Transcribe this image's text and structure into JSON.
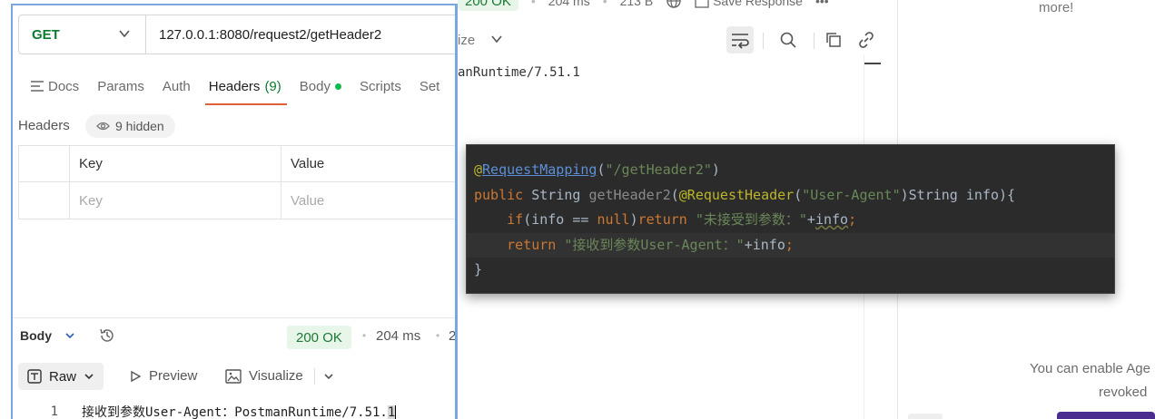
{
  "background": {
    "status": "200 OK",
    "time": "204 ms",
    "size": "213 B",
    "save_response": "Save Response",
    "visualize_fragment": "ize",
    "body_fragment": "anRuntime/7.51.1",
    "right_more": "more!",
    "right_enable": "You can enable Age",
    "right_revoked": "revoked"
  },
  "code": {
    "line1": {
      "at": "@",
      "anno": "RequestMapping",
      "open": "(",
      "str": "\"/getHeader2\"",
      "close": ")"
    },
    "line2": {
      "kw": "public ",
      "type": "String ",
      "fn": "getHeader2",
      "p1": "(",
      "anno": "@RequestHeader",
      "p2": "(",
      "str": "\"User-Agent\"",
      "p3": ")String info){"
    },
    "line3": {
      "kw1": "if",
      "cond": "(info == ",
      "kw2": "null",
      "p": ")",
      "kw3": "return ",
      "str": "\"未接受到参数：\"",
      "plus": "+",
      "var": "info",
      "semi": ";"
    },
    "line4": {
      "kw": "return ",
      "str": "\"接收到参数User-Agent：\"",
      "plus": "+info",
      "semi": ";"
    },
    "line5": "}"
  },
  "request": {
    "method": "GET",
    "url": "127.0.0.1:8080/request2/getHeader2",
    "tabs": [
      {
        "label": "Docs"
      },
      {
        "label": "Params"
      },
      {
        "label": "Auth"
      },
      {
        "label": "Headers",
        "count": "(9)"
      },
      {
        "label": "Body"
      },
      {
        "label": "Scripts"
      },
      {
        "label": "Set"
      }
    ],
    "headers_label": "Headers",
    "hidden_count": "9 hidden",
    "table": {
      "col_key": "Key",
      "col_value": "Value",
      "placeholder_key": "Key",
      "placeholder_value": "Value"
    }
  },
  "response": {
    "body_label": "Body",
    "status": "200 OK",
    "dot": "•",
    "time": "204 ms",
    "size_fragment": "2",
    "formats": {
      "raw": "Raw",
      "preview": "Preview",
      "visualize": "Visualize"
    },
    "line_number": "1",
    "line_text": "接收到参数User-Agent：PostmanRuntime/7.51.",
    "line_selected": "1"
  },
  "colors": {
    "accent_tab": "#e0603a",
    "method_green": "#0c7a33",
    "status_bg": "#e8f5e9",
    "code_bg": "#2b2b2b"
  }
}
